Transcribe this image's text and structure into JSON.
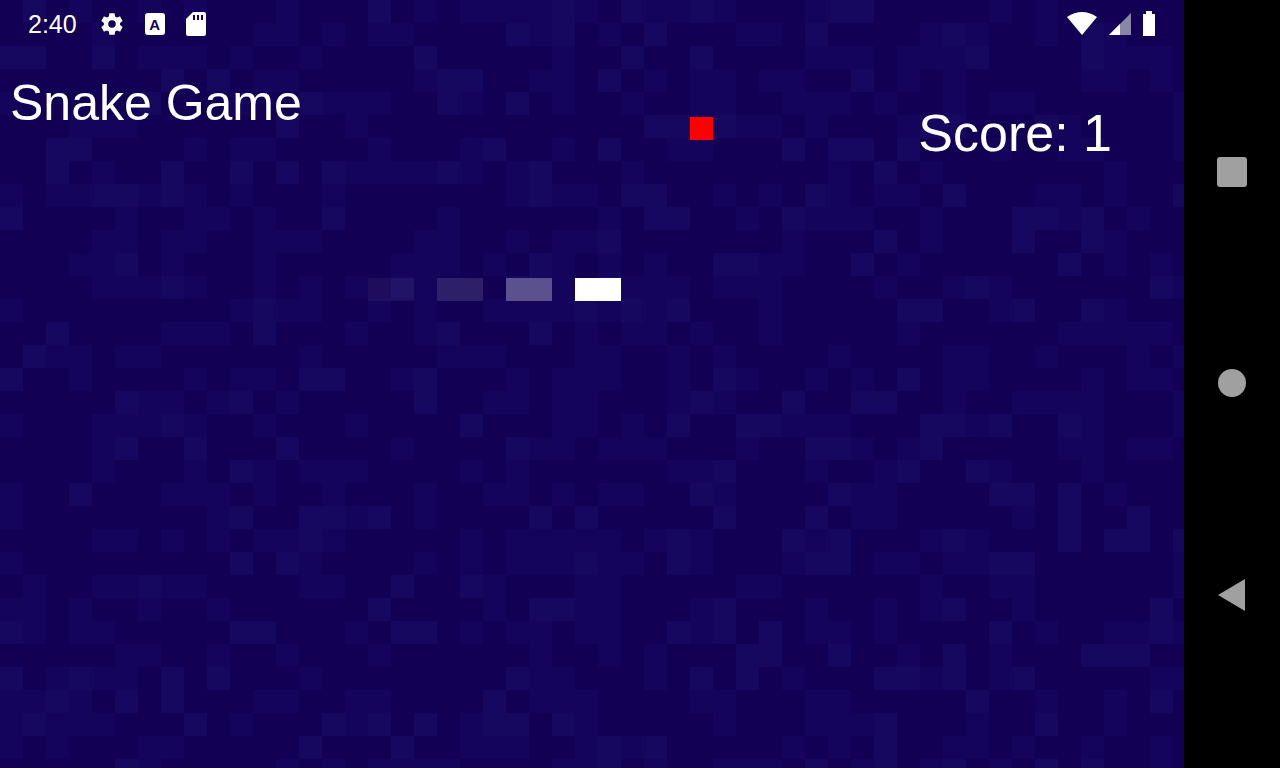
{
  "status_bar": {
    "time": "2:40",
    "notification_letter": "A",
    "wifi_on": true,
    "signal_level": 0.5,
    "battery_level": 1
  },
  "game": {
    "title": "Snake Game",
    "score": "Score: 1",
    "food": {
      "color": "#ff0000"
    },
    "snake": [
      {
        "level": 0.05
      },
      {
        "level": 0.12
      },
      {
        "level": 0.3
      },
      {
        "level": 1
      }
    ]
  }
}
